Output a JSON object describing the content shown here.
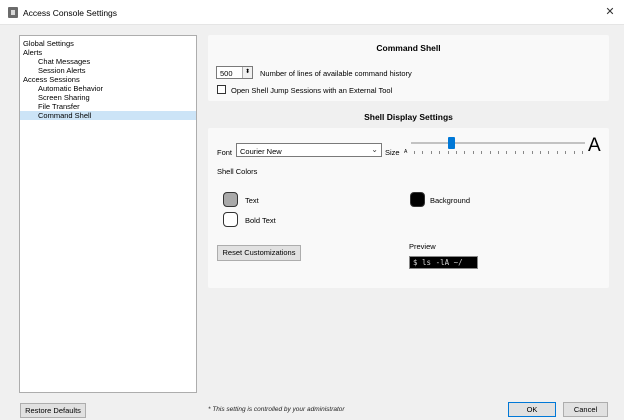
{
  "window": {
    "title": "Access Console Settings",
    "close_glyph": "✕"
  },
  "sidebar": {
    "items": [
      {
        "label": "Global Settings"
      },
      {
        "label": "Alerts"
      },
      {
        "label": "Chat Messages"
      },
      {
        "label": "Session Alerts"
      },
      {
        "label": "Access Sessions"
      },
      {
        "label": "Automatic Behavior"
      },
      {
        "label": "Screen Sharing"
      },
      {
        "label": "File Transfer"
      },
      {
        "label": "Command Shell"
      }
    ],
    "selected": "Command Shell"
  },
  "command_shell": {
    "title": "Command Shell",
    "history_value": "500",
    "history_label": "Number of lines of available command history",
    "external_tool_label": "Open Shell Jump Sessions with an External Tool",
    "external_tool_checked": false
  },
  "display": {
    "title": "Shell Display Settings",
    "font_label": "Font",
    "font_value": "Courier New",
    "size_label": "Size",
    "size_small_glyph": "A",
    "size_large_glyph": "A",
    "size_fraction": 0.21,
    "shell_colors_label": "Shell Colors",
    "colors": {
      "text_label": "Text",
      "text_color": "#a9a9a9",
      "bold_text_label": "Bold Text",
      "bold_text_color": "#ffffff",
      "background_label": "Background",
      "background_color": "#000000"
    },
    "reset_label": "Reset Customizations",
    "preview_label": "Preview",
    "preview_text": "$ ls -lA ~/"
  },
  "footer": {
    "restore_label": "Restore Defaults",
    "footnote": "* This setting is controlled by your administrator",
    "ok_label": "OK",
    "cancel_label": "Cancel"
  },
  "accent_color": "#0078d7"
}
